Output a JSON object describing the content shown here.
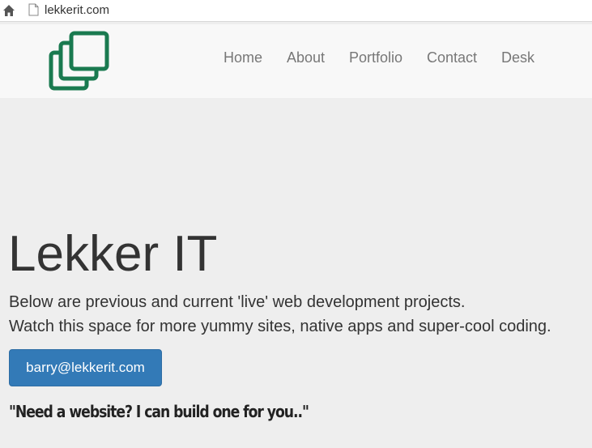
{
  "browser": {
    "url": "lekkerit.com",
    "home_icon": "home-icon",
    "page_icon": "document-icon"
  },
  "navbar": {
    "logo_icon": "stacked-squares-logo",
    "logo_color": "#1a7a50",
    "links": [
      {
        "label": "Home"
      },
      {
        "label": "About"
      },
      {
        "label": "Portfolio"
      },
      {
        "label": "Contact"
      },
      {
        "label": "Desk"
      }
    ]
  },
  "hero": {
    "title": "Lekker IT",
    "line1": "Below are previous and current 'live' web development projects.",
    "line2": "Watch this space for more yummy sites, native apps and super-cool coding.",
    "button_label": "barry@lekkerit.com",
    "button_color": "#337ab7",
    "tagline": "\"Need a website? I can build one for you..\""
  }
}
